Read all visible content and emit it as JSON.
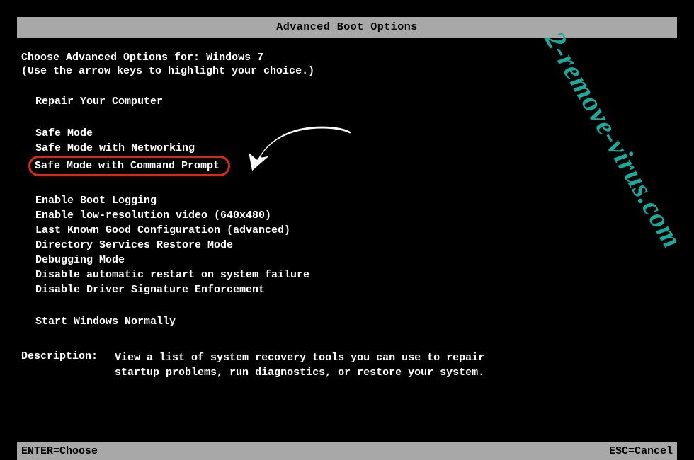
{
  "title": "Advanced Boot Options",
  "intro": {
    "prefix": "Choose Advanced Options for:",
    "os": "Windows 7",
    "hint": "(Use the arrow keys to highlight your choice.)"
  },
  "groups": {
    "repair": [
      "Repair Your Computer"
    ],
    "safe": [
      "Safe Mode",
      "Safe Mode with Networking",
      "Safe Mode with Command Prompt"
    ],
    "advanced": [
      "Enable Boot Logging",
      "Enable low-resolution video (640x480)",
      "Last Known Good Configuration (advanced)",
      "Directory Services Restore Mode",
      "Debugging Mode",
      "Disable automatic restart on system failure",
      "Disable Driver Signature Enforcement"
    ],
    "normal": [
      "Start Windows Normally"
    ]
  },
  "highlighted_option": "Safe Mode with Command Prompt",
  "description": {
    "label": "Description:",
    "text": "View a list of system recovery tools you can use to repair startup problems, run diagnostics, or restore your system."
  },
  "footer": {
    "left": "ENTER=Choose",
    "right": "ESC=Cancel"
  },
  "watermark": "2-remove-virus.com"
}
